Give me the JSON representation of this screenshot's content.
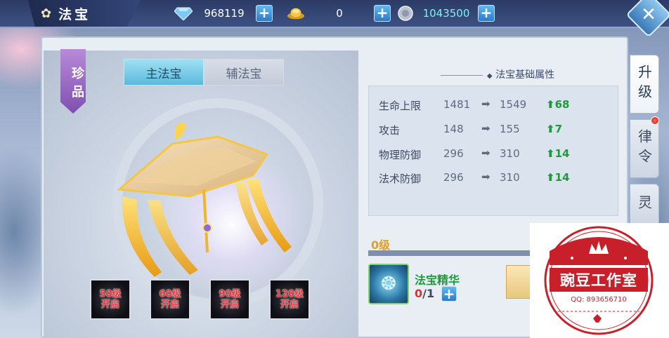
{
  "header": {
    "title": "法宝",
    "title_icon": "flower-icon",
    "diamond_value": "968119",
    "gold_value": "0",
    "silver_value": "1043500",
    "plus_label": "+",
    "close_label": "✕"
  },
  "left": {
    "rarity_badge": "珍品",
    "tabs": [
      {
        "label": "主法宝",
        "active": true
      },
      {
        "label": "辅法宝",
        "active": false
      }
    ],
    "unlocks": [
      {
        "label": "50级开启"
      },
      {
        "label": "60级开启"
      },
      {
        "label": "90级开启"
      },
      {
        "label": "120级开启"
      }
    ]
  },
  "attributes": {
    "title": "法宝基础属性",
    "rows": [
      {
        "name": "生命上限",
        "old": "1481",
        "new": "1549",
        "inc": "68"
      },
      {
        "name": "攻击",
        "old": "148",
        "new": "155",
        "inc": "7"
      },
      {
        "name": "物理防御",
        "old": "296",
        "new": "310",
        "inc": "14"
      },
      {
        "name": "法术防御",
        "old": "296",
        "new": "310",
        "inc": "14"
      }
    ]
  },
  "level": {
    "text": "0级",
    "progress": 0
  },
  "material": {
    "name": "法宝精华",
    "have": "0",
    "need": "/1"
  },
  "side_tabs": [
    {
      "label": "升级",
      "active": true
    },
    {
      "label": "律令",
      "active": false
    },
    {
      "label": "灵",
      "active": false
    }
  ],
  "watermark": {
    "name": "豌豆工作室",
    "qq": "QQ: 893656710"
  },
  "colors": {
    "accent_blue": "#5cb9dc",
    "increase_green": "#1f9a3a",
    "level_gold": "#e0a020",
    "stamp_red": "#c8202a"
  }
}
